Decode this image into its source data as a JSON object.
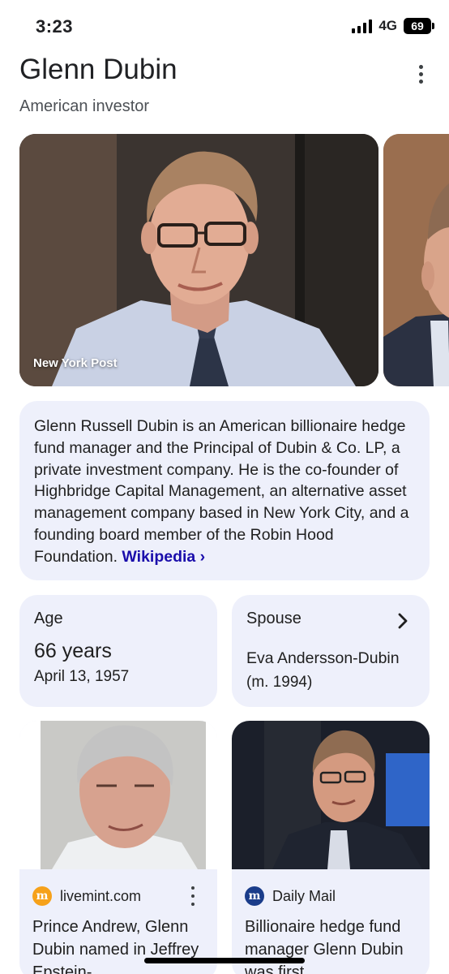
{
  "status_bar": {
    "time": "3:23",
    "network": "4G",
    "battery": "69"
  },
  "header": {
    "title": "Glenn Dubin",
    "subtitle": "American investor"
  },
  "images": {
    "main_caption": "New York Post"
  },
  "description": {
    "text": "Glenn Russell Dubin is an American billionaire hedge fund manager and the Principal of Dubin & Co. LP, a private investment company. He is the co-founder of Highbridge Capital Management, an alternative asset management company based in New York City, and a founding board member of the Robin Hood Foundation.",
    "link_label": "Wikipedia ›"
  },
  "facts": {
    "age": {
      "label": "Age",
      "value": "66 years",
      "detail": "April 13, 1957"
    },
    "spouse": {
      "label": "Spouse",
      "value": "Eva Andersson-Dubin",
      "detail": "(m. 1994)"
    }
  },
  "news": [
    {
      "source": "livemint.com",
      "source_initial": "m",
      "title": "Prince Andrew, Glenn Dubin named in Jeffrey Epstein-"
    },
    {
      "source": "Daily Mail",
      "source_initial": "m",
      "title": "Billionaire hedge fund manager Glenn Dubin was first"
    }
  ],
  "colors": {
    "card_bg": "#eef0fb",
    "link": "#1a0dab",
    "livemint": "#f6a11a",
    "dailymail": "#1a3c8a"
  }
}
